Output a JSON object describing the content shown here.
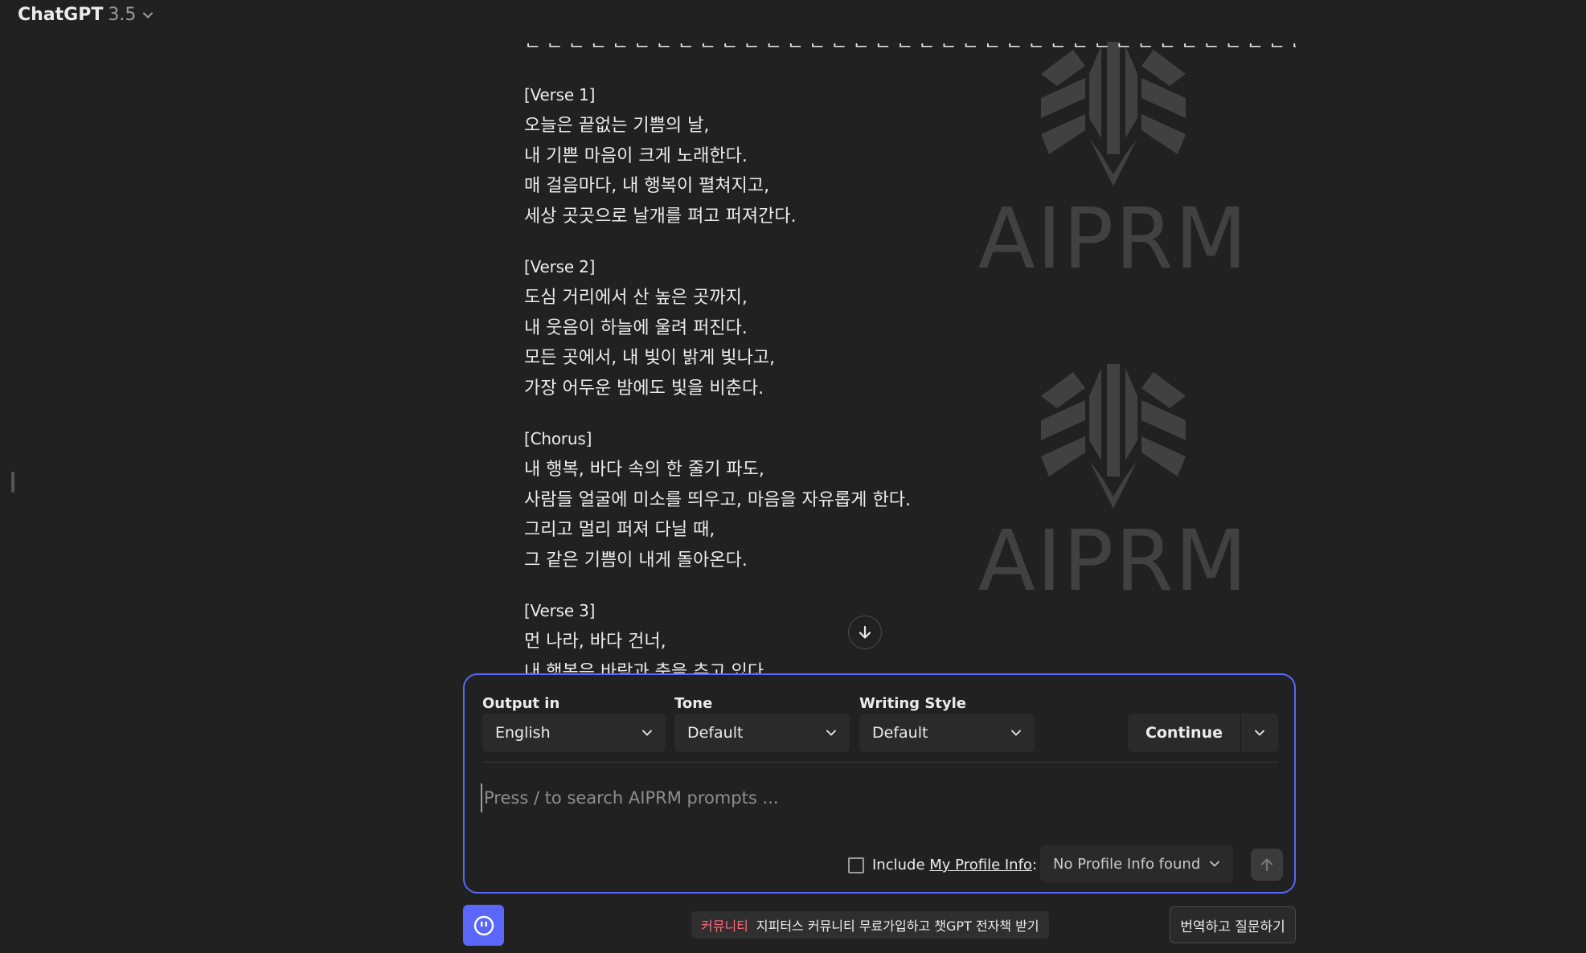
{
  "app": {
    "name": "ChatGPT",
    "version": "3.5"
  },
  "conversation": {
    "partial_top_line": "한 한 한 한 한 한 한 한 한 한 한 한 한 한 한 한 한 한 한 한 한 한 한 한 한 한 한 한 한 한 한 한 한 한 한 한 한 한 한 한 한 한",
    "stanzas": [
      {
        "heading": "[Verse 1]",
        "lines": [
          "오늘은 끝없는 기쁨의 날,",
          "내 기쁜 마음이 크게 노래한다.",
          "매 걸음마다, 내 행복이 펼쳐지고,",
          "세상 곳곳으로 날개를 펴고 퍼져간다."
        ]
      },
      {
        "heading": "[Verse 2]",
        "lines": [
          "도심 거리에서 산 높은 곳까지,",
          "내 웃음이 하늘에 울려 퍼진다.",
          "모든 곳에서, 내 빛이 밝게 빛나고,",
          "가장 어두운 밤에도 빛을 비춘다."
        ]
      },
      {
        "heading": "[Chorus]",
        "lines": [
          "내 행복, 바다 속의 한 줄기 파도,",
          "사람들 얼굴에 미소를 띄우고, 마음을 자유롭게 한다.",
          "그리고 멀리 퍼져 다닐 때,",
          "그 같은 기쁨이 내게 돌아온다."
        ]
      },
      {
        "heading": "[Verse 3]",
        "lines": [
          "먼 나라, 바다 건너,",
          "내 행복은 바람과 춤을 추고 있다."
        ]
      }
    ]
  },
  "watermark": {
    "text": "AIPRM"
  },
  "aiprm_panel": {
    "output_label": "Output in",
    "output_value": "English",
    "tone_label": "Tone",
    "tone_value": "Default",
    "style_label": "Writing Style",
    "style_value": "Default",
    "continue_label": "Continue",
    "prompt_placeholder": "Press / to search AIPRM prompts ...",
    "include_label": "Include",
    "profile_link": "My Profile Info",
    "profile_colon": ":",
    "profile_value": "No Profile Info found"
  },
  "footer": {
    "banner_tag": "커뮤니티",
    "banner_text": "지피터스 커뮤니티 무료가입하고 챗GPT 전자책 받기",
    "translate_button": "번역하고 질문하기"
  },
  "colors": {
    "accent": "#5b67f8",
    "background": "#212121",
    "banner_tag": "#ff6b78"
  },
  "icons": [
    "chevron-down-icon",
    "arrow-down-icon",
    "arrow-up-icon",
    "aiprm-logo-icon",
    "assistant-face-icon"
  ]
}
